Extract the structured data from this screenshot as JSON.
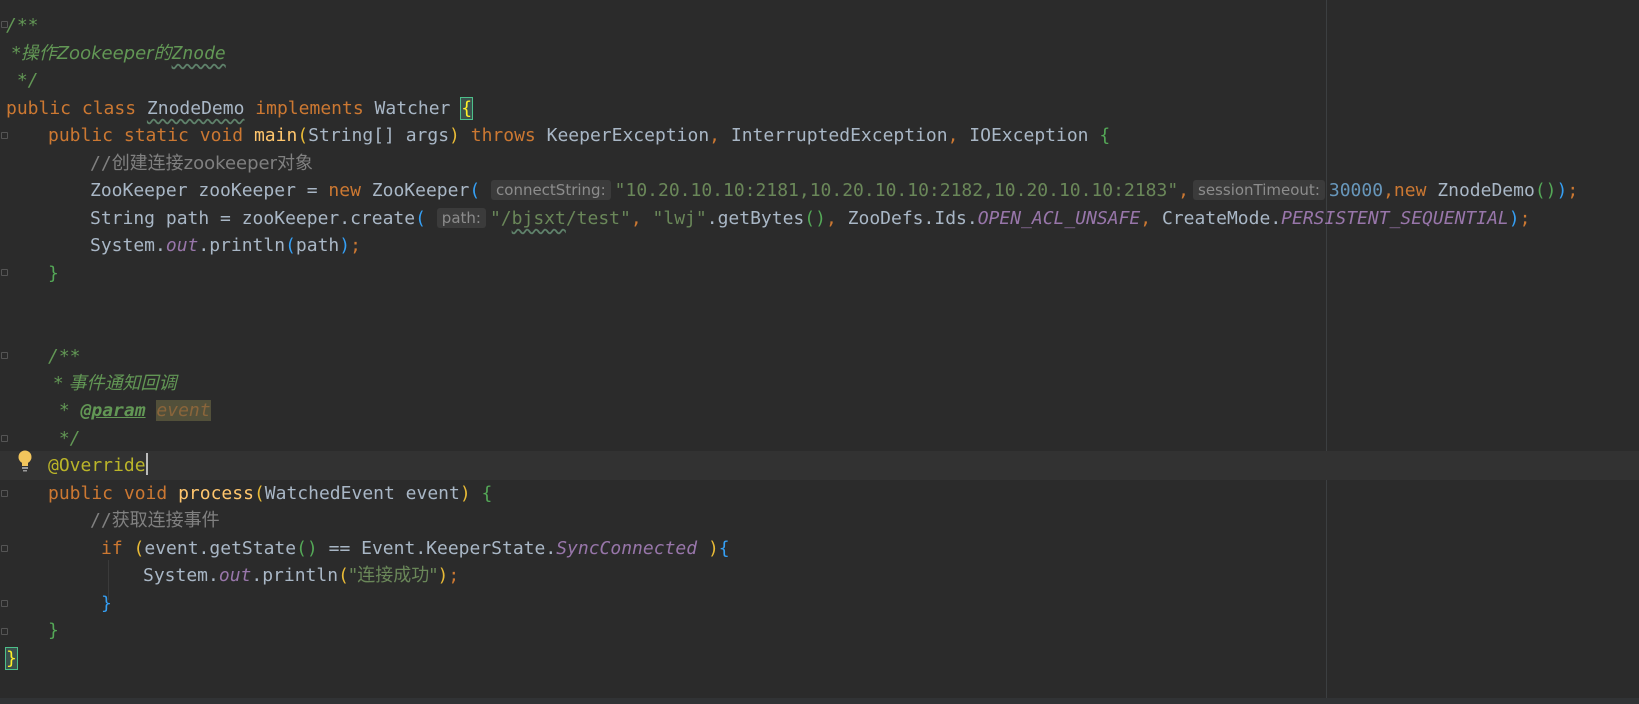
{
  "editor": {
    "language": "Java",
    "lines": {
      "l1": {
        "doc_open": "/**"
      },
      "l2": {
        "doc_text": " *操作Zookeeper的",
        "doc_word": "Znode"
      },
      "l3": {
        "doc_close": " */"
      },
      "l4": {
        "kw1": "public",
        "kw2": "class",
        "class_name": "ZnodeDemo",
        "kw3": "implements",
        "iface": "Watcher",
        "brace": "{"
      },
      "l5": {
        "kw1": "public",
        "kw2": "static",
        "kw3": "void",
        "method": "main",
        "params": "String[] args",
        "kw4": "throws",
        "ex1": "KeeperException",
        "ex2": "InterruptedException",
        "ex3": "IOException",
        "brace": "{"
      },
      "l6": {
        "comment_slashes": "//",
        "comment_text": "创建连接zookeeper对象"
      },
      "l7": {
        "decl": "ZooKeeper zooKeeper = ",
        "kw_new": "new",
        "ctor": "ZooKeeper",
        "hint1": "connectString:",
        "str1": "\"10.20.10.10:2181,10.20.10.10:2182,10.20.10.10:2183\"",
        "hint2": "sessionTimeout:",
        "num": "30000",
        "kw_new2": "new",
        "ctor2": "ZnodeDemo",
        "end": ";"
      },
      "l8": {
        "decl": "String path = zooKeeper.create",
        "hint": "path:",
        "str_a": "\"/",
        "str_u": "bjsxt",
        "str_b": "/test\"",
        "str2": "\"lwj\"",
        "call": ".getBytes",
        "ids": "ZooDefs.Ids.",
        "acl": "OPEN_ACL_UNSAFE",
        "mode_cls": "CreateMode.",
        "mode": "PERSISTENT_SEQUENTIAL",
        "end": ";"
      },
      "l9": {
        "sys": "System.",
        "out": "out",
        "call": ".println",
        "arg": "path",
        "end": ";"
      },
      "l10": {
        "brace": "}"
      },
      "l13": {
        "doc_open": "/**"
      },
      "l14": {
        "doc_text": " * 事件通知回调"
      },
      "l15": {
        "doc_star": " * ",
        "tag": "@param",
        "param": "event"
      },
      "l16": {
        "doc_close": " */"
      },
      "l17": {
        "annotation": "@Override"
      },
      "l18": {
        "kw1": "public",
        "kw2": "void",
        "method": "process",
        "params": "WatchedEvent event",
        "brace": "{"
      },
      "l19": {
        "comment_slashes": "//",
        "comment_text": "获取连接事件"
      },
      "l20": {
        "kw_if": "if",
        "cond_a": "event.getState",
        "cond_b": " == Event.KeeperState.",
        "state": "SyncConnected",
        "brace": "{"
      },
      "l21": {
        "sys": "System.",
        "out": "out",
        "call": ".println",
        "str": "\"连接成功\"",
        "end": ";"
      },
      "l22": {
        "brace": "}"
      },
      "l23": {
        "brace": "}"
      },
      "l24": {
        "brace": "}"
      }
    },
    "colors": {
      "background": "#2b2b2b",
      "keyword": "#cc7832",
      "string": "#6a8759",
      "number": "#6897bb",
      "method": "#ffc66d",
      "doc": "#629755",
      "comment": "#808080",
      "annotation": "#bbb529",
      "static_field": "#9876aa"
    },
    "icons": {
      "intention": "lightbulb-icon"
    }
  }
}
